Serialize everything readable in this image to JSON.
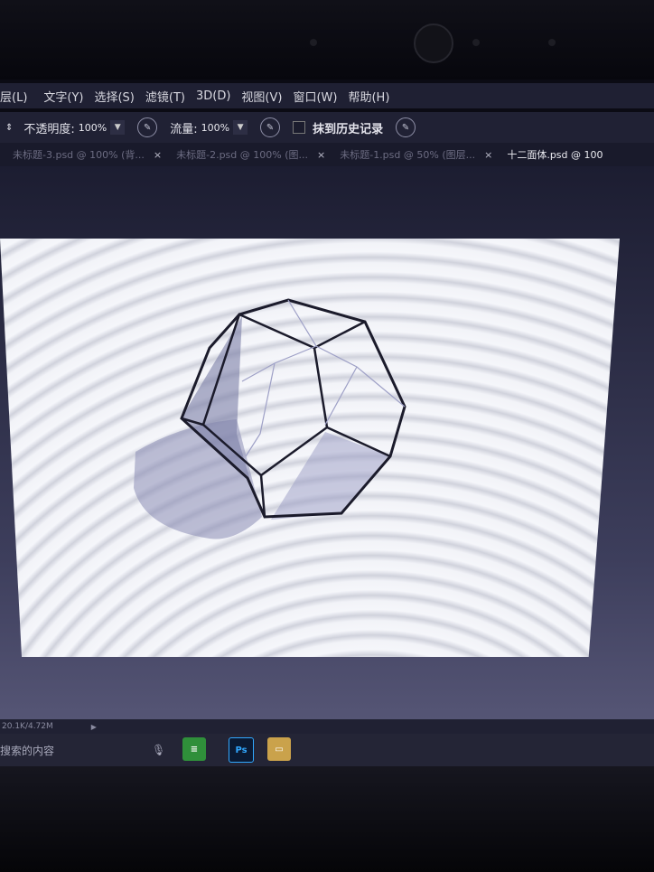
{
  "menu": [
    "层(L)",
    "文字(Y)",
    "选择(S)",
    "滤镜(T)",
    "3D(D)",
    "视图(V)",
    "窗口(W)",
    "帮助(H)"
  ],
  "options": {
    "opacity_label": "不透明度:",
    "opacity_value": "100%",
    "flow_label": "流量:",
    "flow_value": "100%",
    "history_label": "抹到历史记录"
  },
  "tabs": [
    {
      "label": "未标题-3.psd @ 100% (背..."
    },
    {
      "label": "未标题-2.psd @ 100% (图..."
    },
    {
      "label": "未标题-1.psd @ 50% (图层..."
    },
    {
      "label": "十二面体.psd @ 100"
    }
  ],
  "tab_close": "×",
  "status": {
    "doc_size": "20.1K/4.72M"
  },
  "taskbar": {
    "search_text": "搜索的内容"
  },
  "colors": {
    "menubar": "#1f2033",
    "accent": "#2f8f3a",
    "ps_blue": "#31a8ff"
  }
}
